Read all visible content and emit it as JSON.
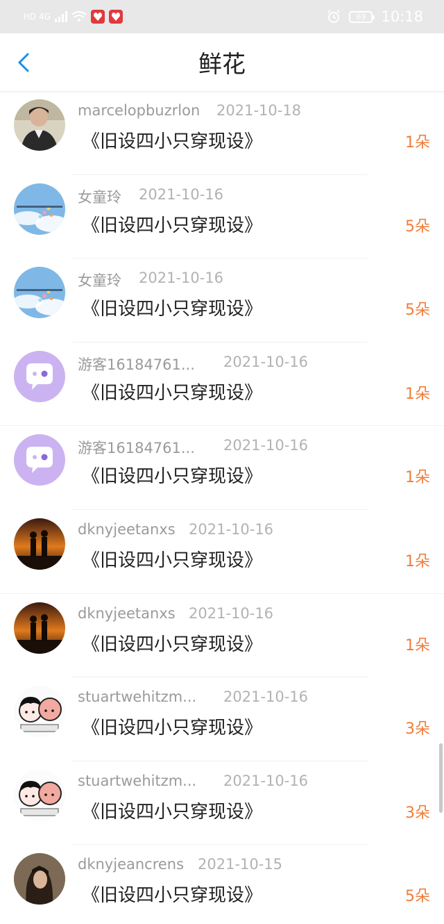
{
  "status_bar": {
    "signal_text": "HD 4G",
    "battery": "69",
    "time": "10:18"
  },
  "header": {
    "title": "鲜花"
  },
  "items": [
    {
      "name": "marcelopbuzrlon",
      "date": "2021-10-18",
      "book": "《旧设四小只穿现设》",
      "count": "1朵",
      "avatar": "avatar-photo-man"
    },
    {
      "name": "女童玲",
      "date": "2021-10-16",
      "book": "《旧设四小只穿现设》",
      "count": "5朵",
      "avatar": "avatar-sky-balloons"
    },
    {
      "name": "女童玲",
      "date": "2021-10-16",
      "book": "《旧设四小只穿现设》",
      "count": "5朵",
      "avatar": "avatar-sky-balloons"
    },
    {
      "name": "游客16184761...",
      "date": "2021-10-16",
      "book": "《旧设四小只穿现设》",
      "count": "1朵",
      "avatar": "avatar-guest-chat"
    },
    {
      "name": "游客16184761...",
      "date": "2021-10-16",
      "book": "《旧设四小只穿现设》",
      "count": "1朵",
      "avatar": "avatar-guest-chat"
    },
    {
      "name": "dknyjeetanxs",
      "date": "2021-10-16",
      "book": "《旧设四小只穿现设》",
      "count": "1朵",
      "avatar": "avatar-sunset-couple"
    },
    {
      "name": "dknyjeetanxs",
      "date": "2021-10-16",
      "book": "《旧设四小只穿现设》",
      "count": "1朵",
      "avatar": "avatar-sunset-couple"
    },
    {
      "name": "stuartwehitzm...",
      "date": "2021-10-16",
      "book": "《旧设四小只穿现设》",
      "count": "3朵",
      "avatar": "avatar-cartoon-kids"
    },
    {
      "name": "stuartwehitzm...",
      "date": "2021-10-16",
      "book": "《旧设四小只穿现设》",
      "count": "3朵",
      "avatar": "avatar-cartoon-kids"
    },
    {
      "name": "dknyjeancrens",
      "date": "2021-10-15",
      "book": "《旧设四小只穿现设》",
      "count": "5朵",
      "avatar": "avatar-photo-girl"
    }
  ],
  "colors": {
    "accent": "#1a8ee6",
    "count": "#f07d3a",
    "name": "#9a9a9a",
    "date": "#b2b2b2"
  }
}
